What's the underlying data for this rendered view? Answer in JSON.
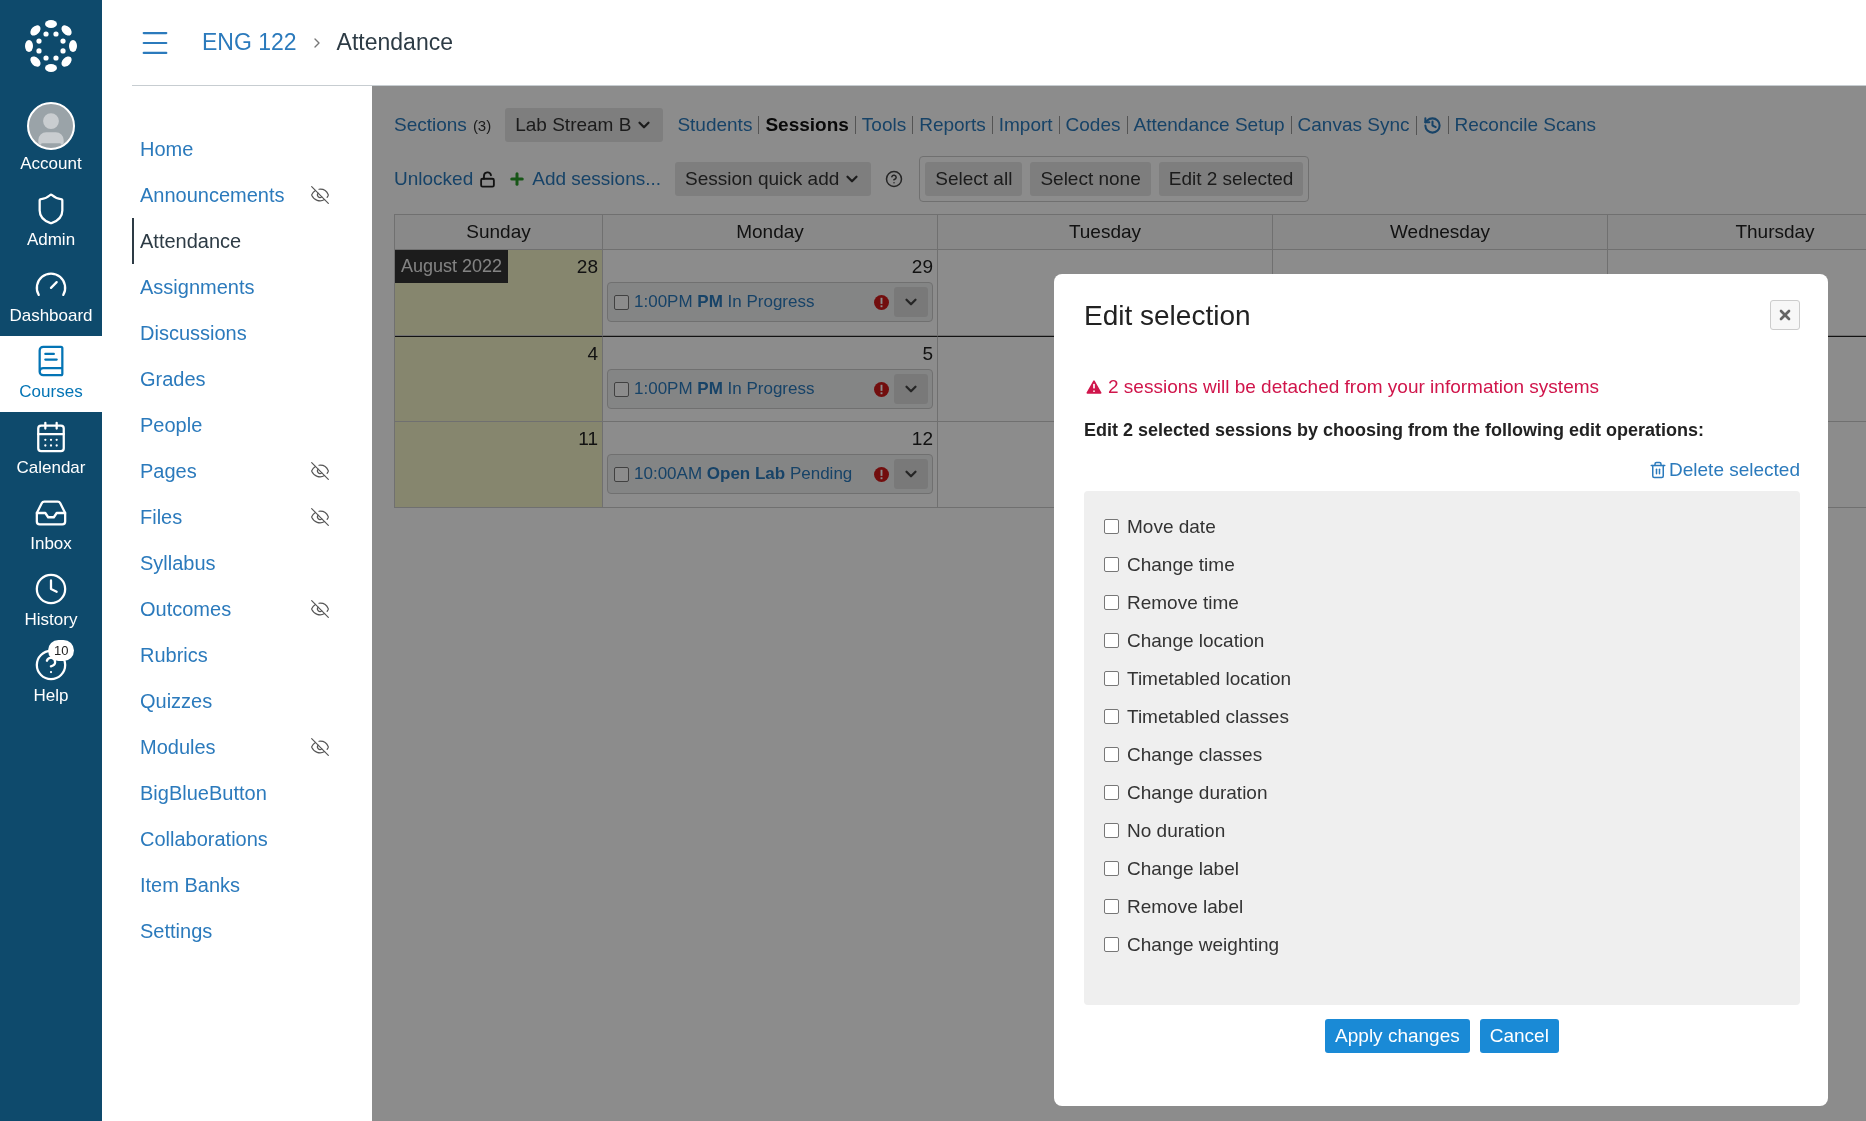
{
  "global_nav": {
    "items": [
      {
        "label": "Account",
        "selected": false
      },
      {
        "label": "Admin",
        "selected": false
      },
      {
        "label": "Dashboard",
        "selected": false
      },
      {
        "label": "Courses",
        "selected": true
      },
      {
        "label": "Calendar",
        "selected": false
      },
      {
        "label": "Inbox",
        "selected": false
      },
      {
        "label": "History",
        "selected": false
      },
      {
        "label": "Help",
        "selected": false,
        "badge": "10"
      }
    ]
  },
  "breadcrumb": [
    "ENG 122",
    "Attendance"
  ],
  "course_nav": [
    {
      "label": "Home",
      "selected": false,
      "hidden": false
    },
    {
      "label": "Announcements",
      "selected": false,
      "hidden": true
    },
    {
      "label": "Attendance",
      "selected": true,
      "hidden": false
    },
    {
      "label": "Assignments",
      "selected": false,
      "hidden": false
    },
    {
      "label": "Discussions",
      "selected": false,
      "hidden": false
    },
    {
      "label": "Grades",
      "selected": false,
      "hidden": false
    },
    {
      "label": "People",
      "selected": false,
      "hidden": false
    },
    {
      "label": "Pages",
      "selected": false,
      "hidden": true
    },
    {
      "label": "Files",
      "selected": false,
      "hidden": true
    },
    {
      "label": "Syllabus",
      "selected": false,
      "hidden": false
    },
    {
      "label": "Outcomes",
      "selected": false,
      "hidden": true
    },
    {
      "label": "Rubrics",
      "selected": false,
      "hidden": false
    },
    {
      "label": "Quizzes",
      "selected": false,
      "hidden": false
    },
    {
      "label": "Modules",
      "selected": false,
      "hidden": true
    },
    {
      "label": "BigBlueButton",
      "selected": false,
      "hidden": false
    },
    {
      "label": "Collaborations",
      "selected": false,
      "hidden": false
    },
    {
      "label": "Item Banks",
      "selected": false,
      "hidden": false
    },
    {
      "label": "Settings",
      "selected": false,
      "hidden": false
    }
  ],
  "toolbar": {
    "sections_label": "Sections",
    "sections_count": "(3)",
    "section_select": "Lab Stream B",
    "tabs": [
      {
        "label": "Students",
        "selected": false
      },
      {
        "label": "Sessions",
        "selected": true
      },
      {
        "label": "Tools",
        "selected": false
      },
      {
        "label": "Reports",
        "selected": false
      },
      {
        "label": "Import",
        "selected": false
      },
      {
        "label": "Codes",
        "selected": false
      },
      {
        "label": "Attendance Setup",
        "selected": false
      },
      {
        "label": "Canvas Sync",
        "selected": false
      }
    ],
    "reconcile": "Reconcile Scans",
    "lock_label": "Unlocked",
    "add_sessions": "Add sessions...",
    "quick_add": "Session quick add",
    "buttons": [
      "Select all",
      "Select none",
      "Edit 2 selected"
    ]
  },
  "calendar": {
    "days": [
      "Sunday",
      "Monday",
      "Tuesday",
      "Wednesday",
      "Thursday"
    ],
    "weeks": [
      {
        "cells": [
          {
            "date": "28",
            "month": "August 2022",
            "shaded": true
          },
          {
            "date": "29",
            "shaded": false,
            "sessions": [
              {
                "checked": false,
                "time": "1:00PM",
                "label": "PM",
                "status": "In Progress"
              }
            ]
          }
        ]
      },
      {
        "cells": [
          {
            "date": "4",
            "shaded": true
          },
          {
            "date": "5",
            "shaded": false,
            "sessions": [
              {
                "checked": false,
                "time": "1:00PM",
                "label": "PM",
                "status": "In Progress"
              }
            ]
          }
        ]
      },
      {
        "cells": [
          {
            "date": "11",
            "shaded": true
          },
          {
            "date": "12",
            "shaded": false,
            "sessions": [
              {
                "checked": false,
                "time": "10:00AM",
                "label": "Open Lab",
                "status": "Pending"
              }
            ]
          }
        ]
      }
    ]
  },
  "modal": {
    "title": "Edit selection",
    "warning": "2 sessions will be detached from your information systems",
    "instruction": "Edit 2 selected sessions by choosing from the following edit operations:",
    "delete_label": "Delete selected",
    "options": [
      {
        "label": "Move date",
        "checked": false
      },
      {
        "label": "Change time",
        "checked": false
      },
      {
        "label": "Remove time",
        "checked": false
      },
      {
        "label": "Change location",
        "checked": false
      },
      {
        "label": "Timetabled location",
        "checked": false
      },
      {
        "label": "Timetabled classes",
        "checked": false
      },
      {
        "label": "Change classes",
        "checked": false
      },
      {
        "label": "Change duration",
        "checked": false
      },
      {
        "label": "No duration",
        "checked": false
      },
      {
        "label": "Change label",
        "checked": false
      },
      {
        "label": "Remove label",
        "checked": false
      },
      {
        "label": "Change weighting",
        "checked": false
      }
    ],
    "buttons": [
      {
        "label": "Apply changes",
        "kind": "primary"
      },
      {
        "label": "Cancel",
        "kind": "primary"
      }
    ]
  }
}
